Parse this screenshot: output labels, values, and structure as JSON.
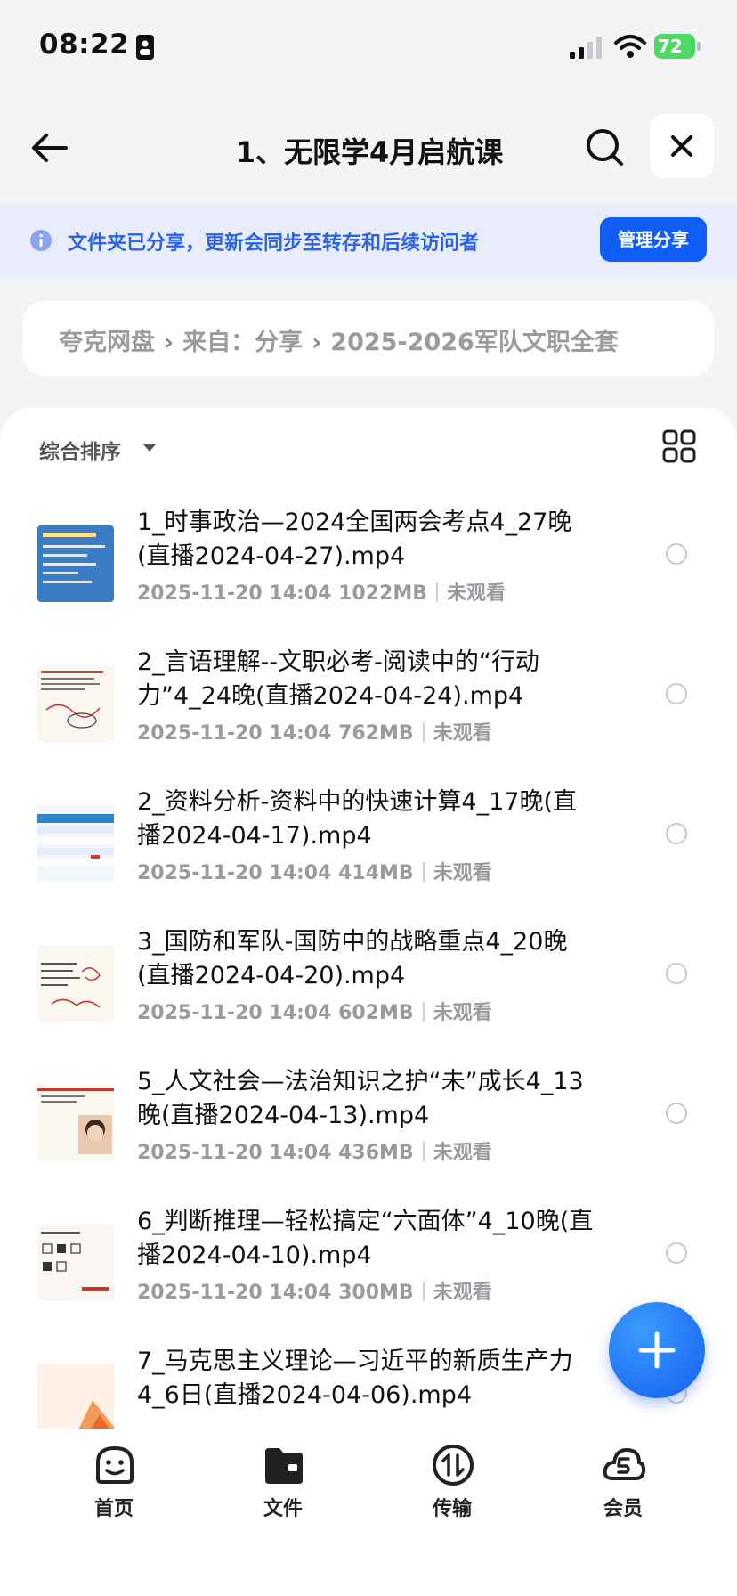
{
  "status_bar": {
    "time": "08:22",
    "battery": "72"
  },
  "header": {
    "title": "1、无限学4月启航课"
  },
  "share_banner": {
    "text": "文件夹已分享，更新会同步至转存和后续访问者",
    "button": "管理分享"
  },
  "breadcrumb": {
    "items": [
      "夸克网盘",
      "来自：分享",
      "2025-2026军队文职全套"
    ]
  },
  "toolbar": {
    "sort_label": "综合排序"
  },
  "files": [
    {
      "name": "1_时事政治—2024全国两会考点4_27晚(直播2024-04-27).mp4",
      "date": "2025-11-20 14:04",
      "size": "1022MB",
      "status": "未观看",
      "thumb": "blue-slide"
    },
    {
      "name": "2_言语理解--文职必考-阅读中的“行动力”4_24晚(直播2024-04-24).mp4",
      "date": "2025-11-20 14:04",
      "size": "762MB",
      "status": "未观看",
      "thumb": "handwriting-slide"
    },
    {
      "name": "2_资料分析-资料中的快速计算4_17晚(直播2024-04-17).mp4",
      "date": "2025-11-20 14:04",
      "size": "414MB",
      "status": "未观看",
      "thumb": "table-slide"
    },
    {
      "name": "3_国防和军队-国防中的战略重点4_20晚(直播2024-04-20).mp4",
      "date": "2025-11-20 14:04",
      "size": "602MB",
      "status": "未观看",
      "thumb": "notes-slide"
    },
    {
      "name": "5_人文社会—法治知识之护“未”成长4_13晚(直播2024-04-13).mp4",
      "date": "2025-11-20 14:04",
      "size": "436MB",
      "status": "未观看",
      "thumb": "photo-slide"
    },
    {
      "name": "6_判断推理—轻松搞定“六面体”4_10晚(直播2024-04-10).mp4",
      "date": "2025-11-20 14:04",
      "size": "300MB",
      "status": "未观看",
      "thumb": "cube-slide"
    },
    {
      "name": "7_马克思主义理论—习近平的新质生产力4_6日(直播2024-04-06).mp4",
      "date": "",
      "size": "",
      "status": "",
      "thumb": "orange-slide"
    }
  ],
  "tabs": [
    {
      "label": "首页",
      "icon": "smile-face-icon"
    },
    {
      "label": "文件",
      "icon": "folder-icon"
    },
    {
      "label": "传输",
      "icon": "transfer-icon"
    },
    {
      "label": "会员",
      "icon": "vip-cloud-icon"
    }
  ],
  "colors": {
    "accent": "#0f5ef7",
    "banner_bg": "#e9ecfb",
    "banner_text": "#2a62e8",
    "meta_gray": "#9a9a9f"
  }
}
